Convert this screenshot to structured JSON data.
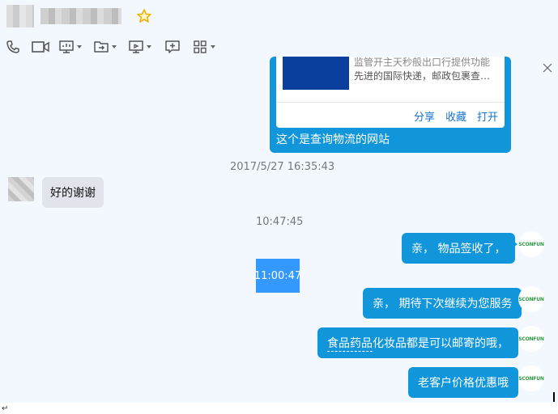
{
  "toolbar": {
    "icons": [
      "phone-icon",
      "video-icon",
      "screen-share-icon",
      "file-transfer-icon",
      "remote-assist-icon",
      "new-chat-icon",
      "apps-grid-icon"
    ]
  },
  "card": {
    "desc_line1": "监管开主天秒般出口行提供功能",
    "desc_line2": "先进的国际快递，邮政包裹查…",
    "actions": {
      "share": "分享",
      "favorite": "收藏",
      "open": "打开"
    },
    "caption": "这个是查询物流的网站"
  },
  "timestamps": {
    "t1": "2017/5/27 16:35:43",
    "t2": "10:47:45",
    "t3": "11:00:47"
  },
  "incoming": {
    "text": "好的谢谢"
  },
  "outgoing": [
    {
      "text": "亲， 物品签收了，"
    },
    {
      "text": "亲， 期待下次继续为您服务"
    },
    {
      "text_underlined": "食品药品",
      "text_rest": "化妆品都是可以邮寄的哦，"
    },
    {
      "text": "老客户价格优惠哦"
    }
  ],
  "agent_avatar_text": "SCONFUN",
  "colors": {
    "bubble_out": "#1296db",
    "bubble_in": "#e1e4ea",
    "background": "#f3f8ff",
    "selection": "#3399ff",
    "star": "#f5c400"
  },
  "paragraph_mark": "↵"
}
